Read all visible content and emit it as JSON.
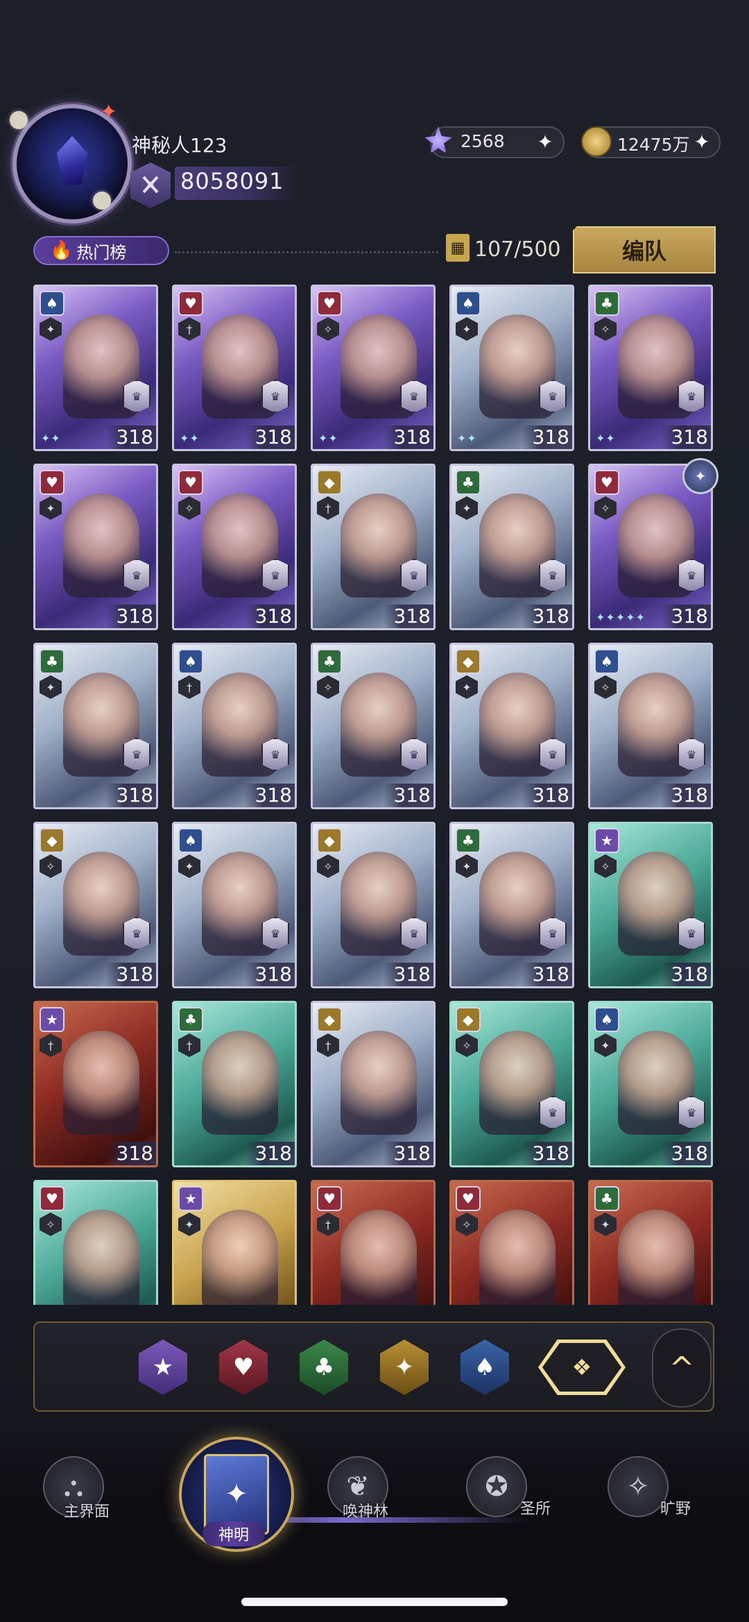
{
  "player": {
    "name": "神秘人123",
    "power": "8058091"
  },
  "currencies": {
    "gems": "2568",
    "gold": "12475万"
  },
  "ranking": {
    "hot_label": "热门榜",
    "card_count": "107/500",
    "formation_label": "编队"
  },
  "cards_row1": [
    {
      "level": "318",
      "suit": "spade"
    },
    {
      "level": "318",
      "suit": "heart"
    },
    {
      "level": "318",
      "suit": "heart"
    },
    {
      "level": "318",
      "suit": "spade"
    },
    {
      "level": "318",
      "suit": "club"
    }
  ],
  "cards_row2": [
    {
      "level": "318",
      "suit": "heart"
    },
    {
      "level": "318",
      "suit": "heart"
    },
    {
      "level": "318",
      "suit": "diamond"
    },
    {
      "level": "318",
      "suit": "club"
    },
    {
      "level": "318",
      "suit": "heart"
    }
  ],
  "cards_row3": [
    {
      "level": "318",
      "suit": "club"
    },
    {
      "level": "318",
      "suit": "spade"
    },
    {
      "level": "318",
      "suit": "club"
    },
    {
      "level": "318",
      "suit": "diamond"
    },
    {
      "level": "318",
      "suit": "spade"
    }
  ],
  "cards_row4": [
    {
      "level": "318",
      "suit": "diamond"
    },
    {
      "level": "318",
      "suit": "spade"
    },
    {
      "level": "318",
      "suit": "diamond"
    },
    {
      "level": "318",
      "suit": "club"
    },
    {
      "level": "318",
      "suit": "star"
    }
  ],
  "cards_row5": [
    {
      "level": "318",
      "suit": "star"
    },
    {
      "level": "318",
      "suit": "club"
    },
    {
      "level": "318",
      "suit": "diamond"
    },
    {
      "level": "318",
      "suit": "diamond"
    },
    {
      "level": "318",
      "suit": "spade"
    }
  ],
  "cards_row6": [
    {
      "suit": "heart"
    },
    {
      "suit": "star"
    },
    {
      "suit": "heart"
    },
    {
      "suit": "heart"
    },
    {
      "suit": "club"
    }
  ],
  "filters": [
    "star",
    "heart",
    "club",
    "diamond",
    "spade",
    "all"
  ],
  "nav": {
    "main_world": "主界面",
    "deities": "神明",
    "summon_forest": "唤神林",
    "sanctuary": "圣所",
    "wilderness": "旷野"
  }
}
